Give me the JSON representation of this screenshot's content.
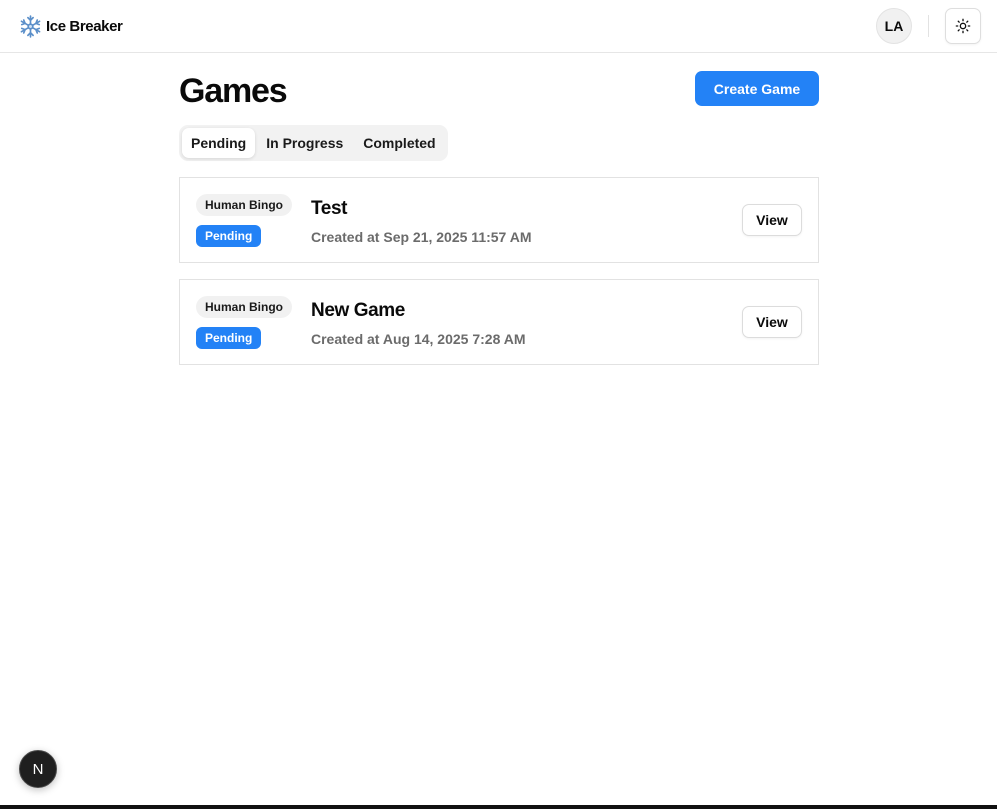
{
  "header": {
    "app_name": "Ice Breaker",
    "avatar_initials": "LA",
    "logo_icon": "snowflake-icon",
    "theme_icon": "sun-icon"
  },
  "main": {
    "title": "Games",
    "create_button": "Create Game",
    "tabs": [
      {
        "label": "Pending",
        "active": true
      },
      {
        "label": "In Progress",
        "active": false
      },
      {
        "label": "Completed",
        "active": false
      }
    ],
    "games": [
      {
        "type": "Human Bingo",
        "status": "Pending",
        "name": "Test",
        "created": "Created at Sep 21, 2025 11:57 AM",
        "action": "View"
      },
      {
        "type": "Human Bingo",
        "status": "Pending",
        "name": "New Game",
        "created": "Created at Aug 14, 2025 7:28 AM",
        "action": "View"
      }
    ]
  },
  "dev_badge": {
    "letter": "N"
  },
  "colors": {
    "accent": "#2382f6",
    "text": "#0a0a0a",
    "muted_text": "#6b6b6b",
    "border": "#e2e2e2"
  }
}
